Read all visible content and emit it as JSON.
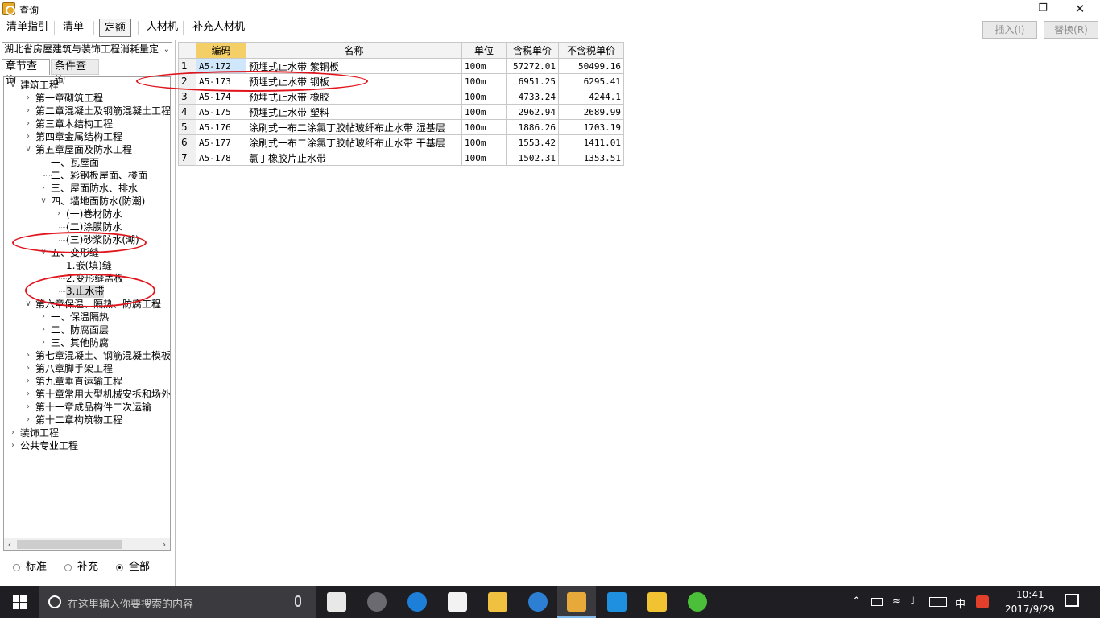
{
  "window": {
    "title": "查询",
    "max_icon": "maximize-icon",
    "close_icon": "close-icon"
  },
  "top_tabs": [
    {
      "label": "清单指引"
    },
    {
      "label": "清单"
    },
    {
      "label": "定额",
      "active": true
    },
    {
      "label": "人材机"
    },
    {
      "label": "补充人材机"
    }
  ],
  "actions": {
    "insert": "插入(I)",
    "replace": "替换(R)"
  },
  "left": {
    "library": "湖北省房屋建筑与装饰工程消耗量定",
    "subtabs": [
      "章节查询",
      "条件查询"
    ],
    "tree": [
      {
        "label": "建筑工程",
        "level": 0,
        "exp": "open"
      },
      {
        "label": "第一章砌筑工程",
        "level": 1,
        "exp": "closed"
      },
      {
        "label": "第二章混凝土及钢筋混凝土工程",
        "level": 1,
        "exp": "closed"
      },
      {
        "label": "第三章木结构工程",
        "level": 1,
        "exp": "closed"
      },
      {
        "label": "第四章金属结构工程",
        "level": 1,
        "exp": "closed"
      },
      {
        "label": "第五章屋面及防水工程",
        "level": 1,
        "exp": "open"
      },
      {
        "label": "一、瓦屋面",
        "level": 2,
        "exp": "none"
      },
      {
        "label": "二、彩钢板屋面、楼面",
        "level": 2,
        "exp": "none"
      },
      {
        "label": "三、屋面防水、排水",
        "level": 2,
        "exp": "closed"
      },
      {
        "label": "四、墙地面防水(防潮)",
        "level": 2,
        "exp": "open"
      },
      {
        "label": "(一)卷材防水",
        "level": 3,
        "exp": "closed"
      },
      {
        "label": "(二)涂膜防水",
        "level": 3,
        "exp": "none"
      },
      {
        "label": "(三)砂浆防水(潮)",
        "level": 3,
        "exp": "none"
      },
      {
        "label": "五、变形缝",
        "level": 2,
        "exp": "open"
      },
      {
        "label": "1.嵌(填)缝",
        "level": 3,
        "exp": "none"
      },
      {
        "label": "2.变形缝盖板",
        "level": 3,
        "exp": "none"
      },
      {
        "label": "3.止水带",
        "level": 3,
        "exp": "none",
        "selected": true
      },
      {
        "label": "第六章保温、隔热、防腐工程",
        "level": 1,
        "exp": "open"
      },
      {
        "label": "一、保温隔热",
        "level": 2,
        "exp": "closed"
      },
      {
        "label": "二、防腐面层",
        "level": 2,
        "exp": "closed"
      },
      {
        "label": "三、其他防腐",
        "level": 2,
        "exp": "closed"
      },
      {
        "label": "第七章混凝土、钢筋混凝土模板",
        "level": 1,
        "exp": "closed"
      },
      {
        "label": "第八章脚手架工程",
        "level": 1,
        "exp": "closed"
      },
      {
        "label": "第九章垂直运输工程",
        "level": 1,
        "exp": "closed"
      },
      {
        "label": "第十章常用大型机械安拆和场外",
        "level": 1,
        "exp": "closed"
      },
      {
        "label": "第十一章成品构件二次运输",
        "level": 1,
        "exp": "closed"
      },
      {
        "label": "第十二章构筑物工程",
        "level": 1,
        "exp": "closed"
      },
      {
        "label": "装饰工程",
        "level": 0,
        "exp": "closed"
      },
      {
        "label": "公共专业工程",
        "level": 0,
        "exp": "closed"
      }
    ],
    "radios": [
      {
        "label": "标准",
        "checked": false
      },
      {
        "label": "补充",
        "checked": false
      },
      {
        "label": "全部",
        "checked": true
      }
    ]
  },
  "table": {
    "headers": [
      "",
      "编码",
      "名称",
      "单位",
      "含税单价",
      "不含税单价"
    ],
    "rows": [
      {
        "no": "1",
        "code": "A5-172",
        "name": "预埋式止水带 紫铜板",
        "unit": "100m",
        "tax_price": "57272.01",
        "notax_price": "50499.16"
      },
      {
        "no": "2",
        "code": "A5-173",
        "name": "预埋式止水带 钢板",
        "unit": "100m",
        "tax_price": "6951.25",
        "notax_price": "6295.41"
      },
      {
        "no": "3",
        "code": "A5-174",
        "name": "预埋式止水带 橡胶",
        "unit": "100m",
        "tax_price": "4733.24",
        "notax_price": "4244.1"
      },
      {
        "no": "4",
        "code": "A5-175",
        "name": "预埋式止水带 塑料",
        "unit": "100m",
        "tax_price": "2962.94",
        "notax_price": "2689.99"
      },
      {
        "no": "5",
        "code": "A5-176",
        "name": "涂刷式一布二涂氯丁胶帖玻纤布止水带 湿基层",
        "unit": "100m",
        "tax_price": "1886.26",
        "notax_price": "1703.19"
      },
      {
        "no": "6",
        "code": "A5-177",
        "name": "涂刷式一布二涂氯丁胶帖玻纤布止水带 干基层",
        "unit": "100m",
        "tax_price": "1553.42",
        "notax_price": "1411.01"
      },
      {
        "no": "7",
        "code": "A5-178",
        "name": "氯丁橡胶片止水带",
        "unit": "100m",
        "tax_price": "1502.31",
        "notax_price": "1353.51"
      }
    ]
  },
  "taskbar": {
    "search_placeholder": "在这里输入你要搜索的内容",
    "ime": "中",
    "time": "10:41",
    "date": "2017/9/29",
    "apps": [
      "windmill-icon",
      "browser-icon",
      "edge-icon",
      "store-icon",
      "explorer-icon",
      "glodon-icon",
      "notes-icon",
      "plus-icon",
      "help-icon",
      "green-app-icon"
    ]
  },
  "colors": {
    "highlight_header": "#f4cf67",
    "annotation_red": "#e0141c",
    "taskbar": "#1f1f23"
  }
}
